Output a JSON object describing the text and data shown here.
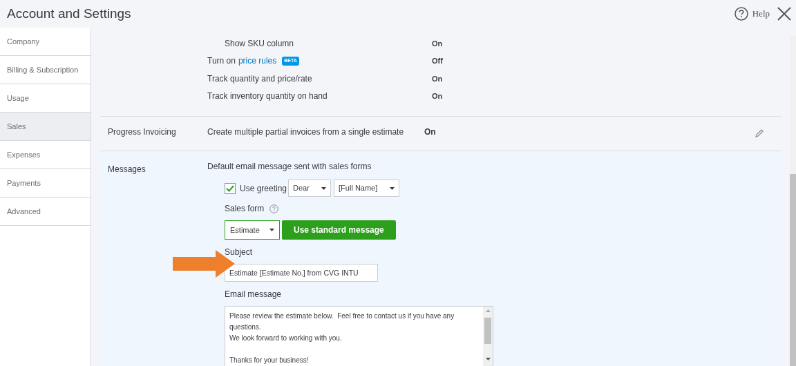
{
  "window": {
    "title": "Account and Settings",
    "help": "Help"
  },
  "sidebar": {
    "items": [
      {
        "label": "Company",
        "selected": false
      },
      {
        "label": "Billing & Subscription",
        "selected": false
      },
      {
        "label": "Usage",
        "selected": false
      },
      {
        "label": "Sales",
        "selected": true
      },
      {
        "label": "Expenses",
        "selected": false
      },
      {
        "label": "Payments",
        "selected": false
      },
      {
        "label": "Advanced",
        "selected": false
      }
    ]
  },
  "products_rows": [
    {
      "kind": "sub",
      "label": "Show SKU column",
      "value": "On"
    },
    {
      "kind": "link",
      "prefix": "Turn on",
      "link": "price rules",
      "badge": "BETA",
      "value": "Off"
    },
    {
      "kind": "plain",
      "label": "Track quantity and price/rate",
      "value": "On"
    },
    {
      "kind": "plain",
      "label": "Track inventory quantity on hand",
      "value": "On"
    }
  ],
  "progress_invoicing": {
    "label": "Progress Invoicing",
    "description": "Create multiple partial invoices from a single estimate",
    "value": "On"
  },
  "messages": {
    "label": "Messages",
    "heading": "Default email message sent with sales forms",
    "use_greeting": {
      "label": "Use greeting",
      "checked": true
    },
    "greeting": "Dear",
    "name_format": "[Full Name]",
    "sales_form_label": "Sales form",
    "sales_form": "Estimate",
    "standard_button": "Use standard message",
    "subject_label": "Subject",
    "subject": "Estimate [Estimate No.] from CVG INTU",
    "email_label": "Email message",
    "email_message": "Please review the estimate below.  Feel free to contact us if you have any questions.\nWe look forward to working with you.\n\nThanks for your business!"
  }
}
